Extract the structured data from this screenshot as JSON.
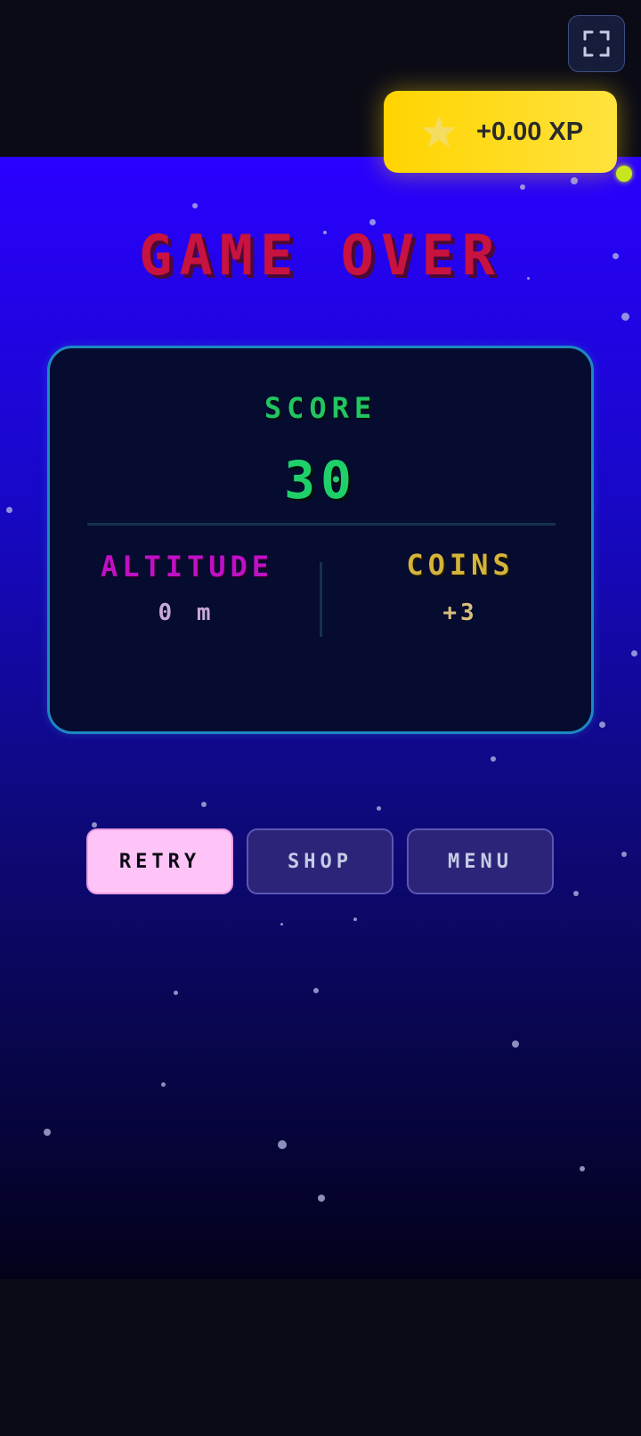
{
  "hud": {
    "fullscreen_icon": "fullscreen-icon",
    "xp_icon": "star-icon",
    "xp_text": "+0.00 XP",
    "xp_color": "#ffd400"
  },
  "game_over": {
    "title": "GAME OVER",
    "title_color": "#c8123f",
    "score_label": "SCORE",
    "score_value": "30",
    "altitude_label": "ALTITUDE",
    "altitude_value": "0 m",
    "coins_label": "COINS",
    "coins_value": "+3"
  },
  "buttons": {
    "retry": "RETRY",
    "shop": "SHOP",
    "menu": "MENU"
  }
}
